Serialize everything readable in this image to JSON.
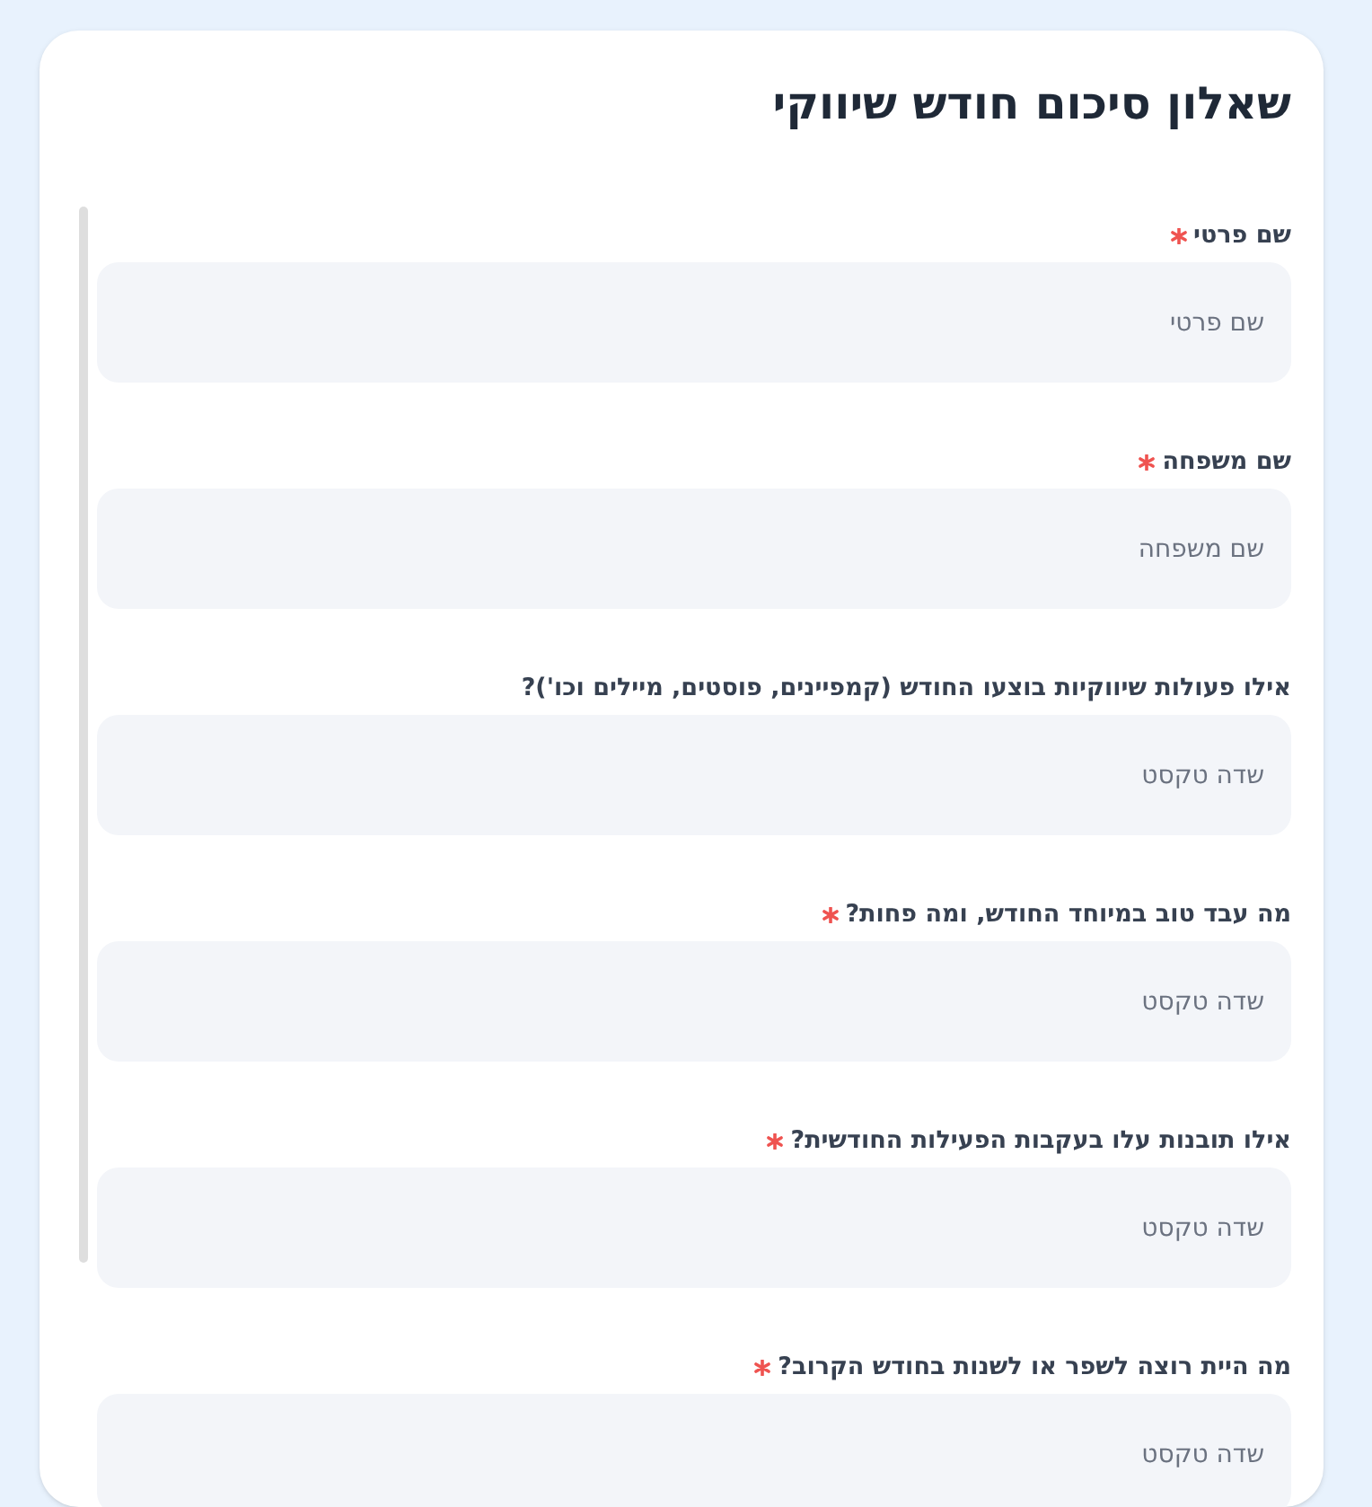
{
  "title": "שאלון סיכום חודש שיווקי",
  "questions": [
    {
      "label": "שם פרטי",
      "required": true,
      "placeholder": "שם פרטי"
    },
    {
      "label": "שם משפחה",
      "required": true,
      "placeholder": "שם משפחה"
    },
    {
      "label": "אילו פעולות שיווקיות בוצעו החודש (קמפיינים, פוסטים, מיילים וכו')?",
      "required": false,
      "placeholder": "שדה טקסט"
    },
    {
      "label": "מה עבד טוב במיוחד החודש, ומה פחות?",
      "required": true,
      "placeholder": "שדה טקסט"
    },
    {
      "label": "אילו תובנות עלו בעקבות הפעילות החודשית?",
      "required": true,
      "placeholder": "שדה טקסט"
    },
    {
      "label": "מה היית רוצה לשפר או לשנות בחודש הקרוב?",
      "required": true,
      "placeholder": "שדה טקסט"
    }
  ]
}
